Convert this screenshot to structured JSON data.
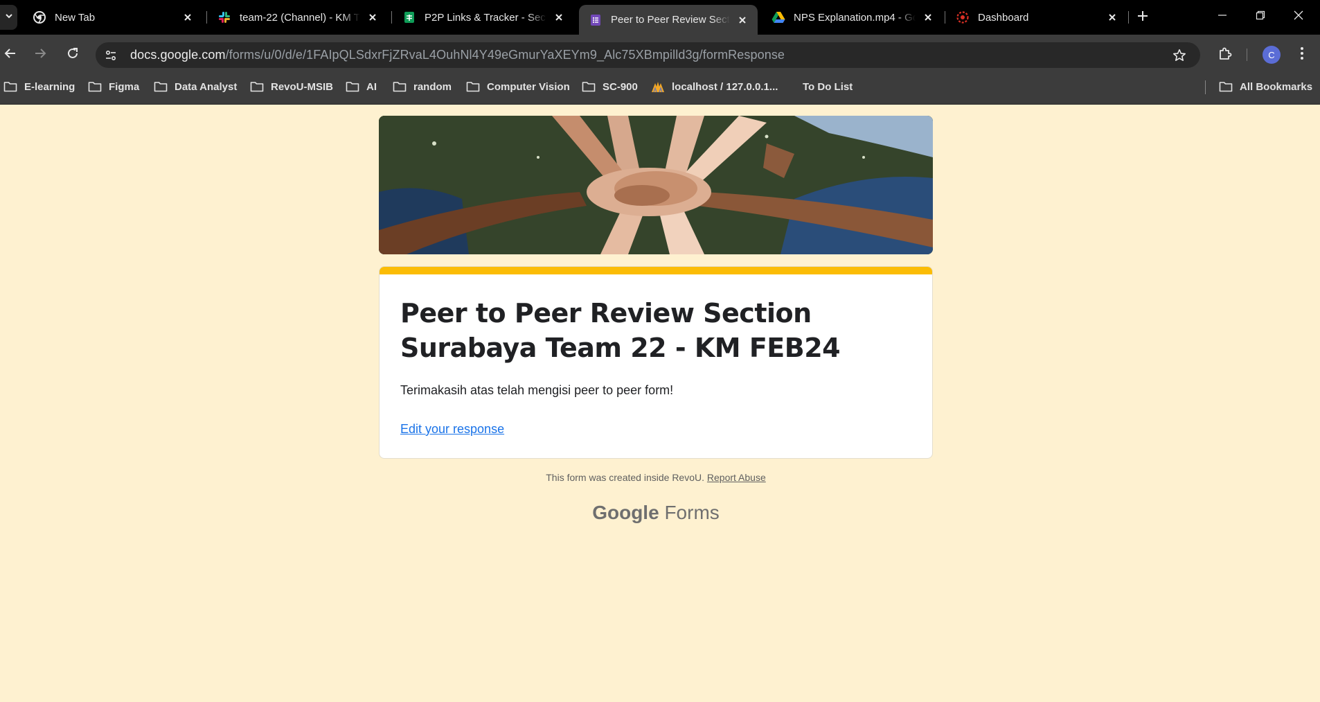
{
  "tabs": [
    {
      "title": "New Tab",
      "icon": "chrome-icon",
      "active": false
    },
    {
      "title": "team-22 (Channel) - KM T",
      "icon": "slack-icon",
      "active": false
    },
    {
      "title": "P2P Links & Tracker - Secti",
      "icon": "sheets-icon",
      "active": false
    },
    {
      "title": "Peer to Peer Review Sectio",
      "icon": "forms-icon",
      "active": true
    },
    {
      "title": "NPS Explanation.mp4 - Go",
      "icon": "drive-icon",
      "active": false
    },
    {
      "title": "Dashboard",
      "icon": "dashboard-icon",
      "active": false
    }
  ],
  "address_bar": {
    "host": "docs.google.com",
    "path": "/forms/u/0/d/e/1FAIpQLSdxrFjZRvaL4OuhNl4Y49eGmurYaXEYm9_Alc75XBmpilld3g/formResponse"
  },
  "profile": {
    "initial": "C",
    "color": "#5b6dd6"
  },
  "bookmarks": [
    {
      "label": "E-learning",
      "icon": "folder-icon"
    },
    {
      "label": "Figma",
      "icon": "folder-icon"
    },
    {
      "label": "Data Analyst",
      "icon": "folder-icon"
    },
    {
      "label": "RevoU-MSIB",
      "icon": "folder-icon"
    },
    {
      "label": "AI",
      "icon": "folder-icon"
    },
    {
      "label": "random",
      "icon": "folder-icon"
    },
    {
      "label": "Computer Vision",
      "icon": "folder-icon"
    },
    {
      "label": "SC-900",
      "icon": "folder-icon"
    },
    {
      "label": "localhost / 127.0.0.1...",
      "icon": "phpmyadmin-icon"
    },
    {
      "label": "To Do List",
      "icon": "none"
    }
  ],
  "all_bookmarks": "All Bookmarks",
  "form": {
    "title": "Peer to Peer Review Section Surabaya Team 22 - KM FEB24",
    "message": "Terimakasih atas telah mengisi peer to peer form!",
    "edit_link": "Edit your response",
    "accent_color": "#fbbc05",
    "background_color": "#fef1d0"
  },
  "footer": {
    "note": "This form was created inside RevoU.",
    "report": "Report Abuse",
    "brand_google": "Google",
    "brand_forms": "Forms"
  }
}
